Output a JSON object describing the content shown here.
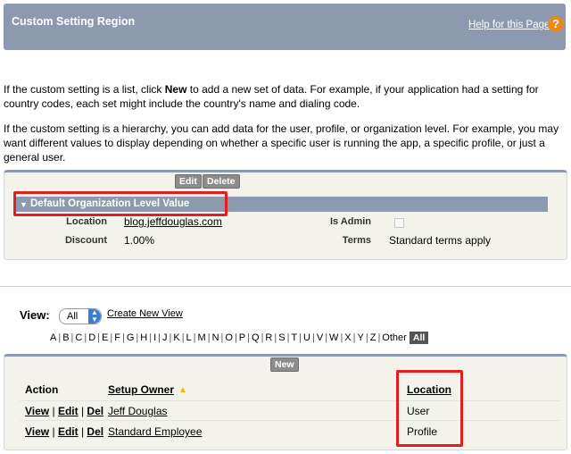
{
  "header": {
    "title": "Custom Setting Region",
    "help_link": "Help for this Page",
    "help_icon": "question-icon"
  },
  "intro": {
    "p1_a": "If the custom setting is a list, click ",
    "p1_new": "New",
    "p1_b": " to add a new set of data. For example, if your application had a setting for country codes, each set might include the country's name and dialing code.",
    "p2": "If the custom setting is a hierarchy, you can add data for the user, profile, or organization level. For example, you may want different values to display depending on whether a specific user is running the app, a specific profile, or just a general user."
  },
  "detail": {
    "edit_label": "Edit",
    "delete_label": "Delete",
    "section_title": "Default Organization Level Value",
    "fields": {
      "location_label": "Location",
      "location_value": "blog.jeffdouglas.com",
      "is_admin_label": "Is Admin",
      "discount_label": "Discount",
      "discount_value": "1.00%",
      "terms_label": "Terms",
      "terms_value": "Standard terms apply"
    }
  },
  "view": {
    "label": "View:",
    "selected": "All",
    "create_link": "Create New View"
  },
  "alphabet": [
    "A",
    "B",
    "C",
    "D",
    "E",
    "F",
    "G",
    "H",
    "I",
    "J",
    "K",
    "L",
    "M",
    "N",
    "O",
    "P",
    "Q",
    "R",
    "S",
    "T",
    "U",
    "V",
    "W",
    "X",
    "Y",
    "Z"
  ],
  "alphabet_other": "Other",
  "alphabet_all": "All",
  "list": {
    "new_label": "New",
    "columns": {
      "action": "Action",
      "owner": "Setup Owner",
      "location": "Location"
    },
    "rows": [
      {
        "view": "View",
        "edit": "Edit",
        "del": "Del",
        "owner": "Jeff Douglas",
        "location": "User"
      },
      {
        "view": "View",
        "edit": "Edit",
        "del": "Del",
        "owner": "Standard Employee",
        "location": "Profile"
      }
    ]
  },
  "colors": {
    "header_band": "#8d99ae",
    "highlight_box": "#e21e1e",
    "help_icon": "#e8891a"
  }
}
